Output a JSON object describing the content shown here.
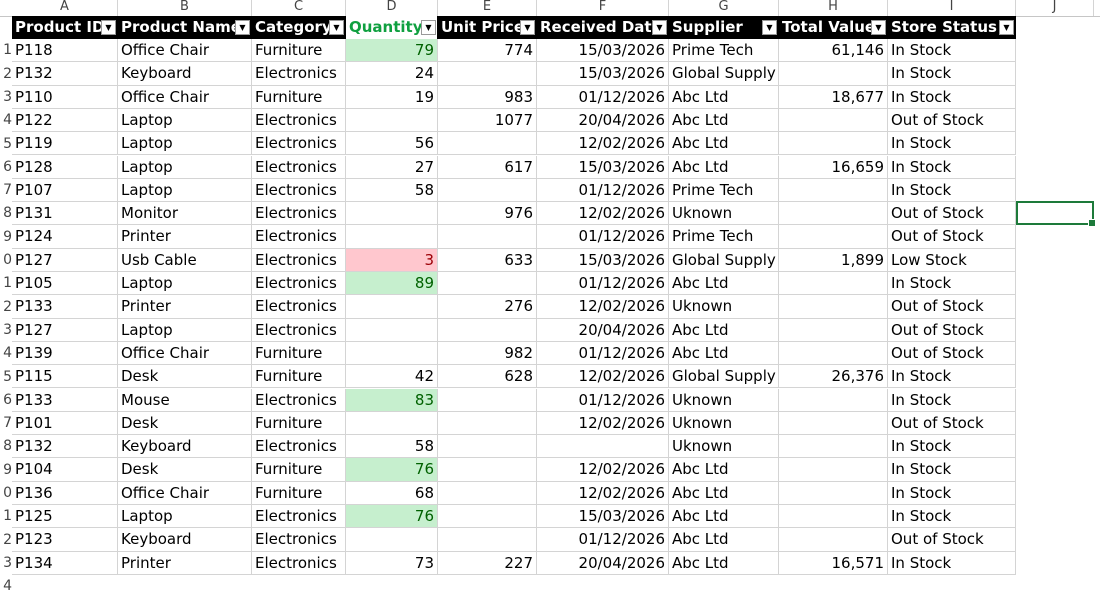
{
  "columns": [
    "A",
    "B",
    "C",
    "D",
    "E",
    "F",
    "G",
    "H",
    "I",
    "J"
  ],
  "row_numbers": [
    "",
    "1",
    "2",
    "3",
    "4",
    "5",
    "6",
    "7",
    "8",
    "9",
    "0",
    "1",
    "2",
    "3",
    "4",
    "5",
    "6",
    "7",
    "8",
    "9",
    "0",
    "1",
    "2",
    "3",
    "4"
  ],
  "headers": [
    "Product ID",
    "Product Name",
    "Category",
    "Quantity",
    "Unit Price",
    "Received Date",
    "Supplier",
    "Total Value",
    "Store Status"
  ],
  "rows": [
    [
      "P118",
      "Office Chair",
      "Furniture",
      "79",
      "774",
      "15/03/2026",
      "Prime Tech",
      "61,146",
      "In Stock"
    ],
    [
      "P132",
      "Keyboard",
      "Electronics",
      "24",
      "",
      "15/03/2026",
      "Global Supply",
      "",
      "In Stock"
    ],
    [
      "P110",
      "Office Chair",
      "Furniture",
      "19",
      "983",
      "01/12/2026",
      "Abc Ltd",
      "18,677",
      "In Stock"
    ],
    [
      "P122",
      "Laptop",
      "Electronics",
      "",
      "1077",
      "20/04/2026",
      "Abc Ltd",
      "",
      "Out of Stock"
    ],
    [
      "P119",
      "Laptop",
      "Electronics",
      "56",
      "",
      "12/02/2026",
      "Abc Ltd",
      "",
      "In Stock"
    ],
    [
      "P128",
      "Laptop",
      "Electronics",
      "27",
      "617",
      "15/03/2026",
      "Abc Ltd",
      "16,659",
      "In Stock"
    ],
    [
      "P107",
      "Laptop",
      "Electronics",
      "58",
      "",
      "01/12/2026",
      "Prime Tech",
      "",
      "In Stock"
    ],
    [
      "P131",
      "Monitor",
      "Electronics",
      "",
      "976",
      "12/02/2026",
      "Uknown",
      "",
      "Out of Stock"
    ],
    [
      "P124",
      "Printer",
      "Electronics",
      "",
      "",
      "01/12/2026",
      "Prime Tech",
      "",
      "Out of Stock"
    ],
    [
      "P127",
      "Usb Cable",
      "Electronics",
      "3",
      "633",
      "15/03/2026",
      "Global Supply",
      "1,899",
      "Low Stock"
    ],
    [
      "P105",
      "Laptop",
      "Electronics",
      "89",
      "",
      "01/12/2026",
      "Abc Ltd",
      "",
      "In Stock"
    ],
    [
      "P133",
      "Printer",
      "Electronics",
      "",
      "276",
      "12/02/2026",
      "Uknown",
      "",
      "Out of Stock"
    ],
    [
      "P127",
      "Laptop",
      "Electronics",
      "",
      "",
      "20/04/2026",
      "Abc Ltd",
      "",
      "Out of Stock"
    ],
    [
      "P139",
      "Office Chair",
      "Furniture",
      "",
      "982",
      "01/12/2026",
      "Abc Ltd",
      "",
      "Out of Stock"
    ],
    [
      "P115",
      "Desk",
      "Furniture",
      "42",
      "628",
      "12/02/2026",
      "Global Supply",
      "26,376",
      "In Stock"
    ],
    [
      "P133",
      "Mouse",
      "Electronics",
      "83",
      "",
      "01/12/2026",
      "Uknown",
      "",
      "In Stock"
    ],
    [
      "P101",
      "Desk",
      "Furniture",
      "",
      "",
      "12/02/2026",
      "Uknown",
      "",
      "Out of Stock"
    ],
    [
      "P132",
      "Keyboard",
      "Electronics",
      "58",
      "",
      "",
      "Uknown",
      "",
      "In Stock"
    ],
    [
      "P104",
      "Desk",
      "Furniture",
      "76",
      "",
      "12/02/2026",
      "Abc Ltd",
      "",
      "In Stock"
    ],
    [
      "P136",
      "Office Chair",
      "Furniture",
      "68",
      "",
      "12/02/2026",
      "Abc Ltd",
      "",
      "In Stock"
    ],
    [
      "P125",
      "Laptop",
      "Electronics",
      "76",
      "",
      "15/03/2026",
      "Abc Ltd",
      "",
      "In Stock"
    ],
    [
      "P123",
      "Keyboard",
      "Electronics",
      "",
      "",
      "01/12/2026",
      "Abc Ltd",
      "",
      "Out of Stock"
    ],
    [
      "P134",
      "Printer",
      "Electronics",
      "73",
      "227",
      "20/04/2026",
      "Abc Ltd",
      "16,571",
      "In Stock"
    ]
  ],
  "highlight": {
    "green_rows": [
      0,
      10,
      15,
      18,
      20
    ],
    "pink_rows": [
      9
    ]
  },
  "colors": {
    "green_fill": "#c6efce",
    "pink_fill": "#ffc7ce",
    "header_fill": "#000000",
    "selection": "#1d7a3a"
  }
}
